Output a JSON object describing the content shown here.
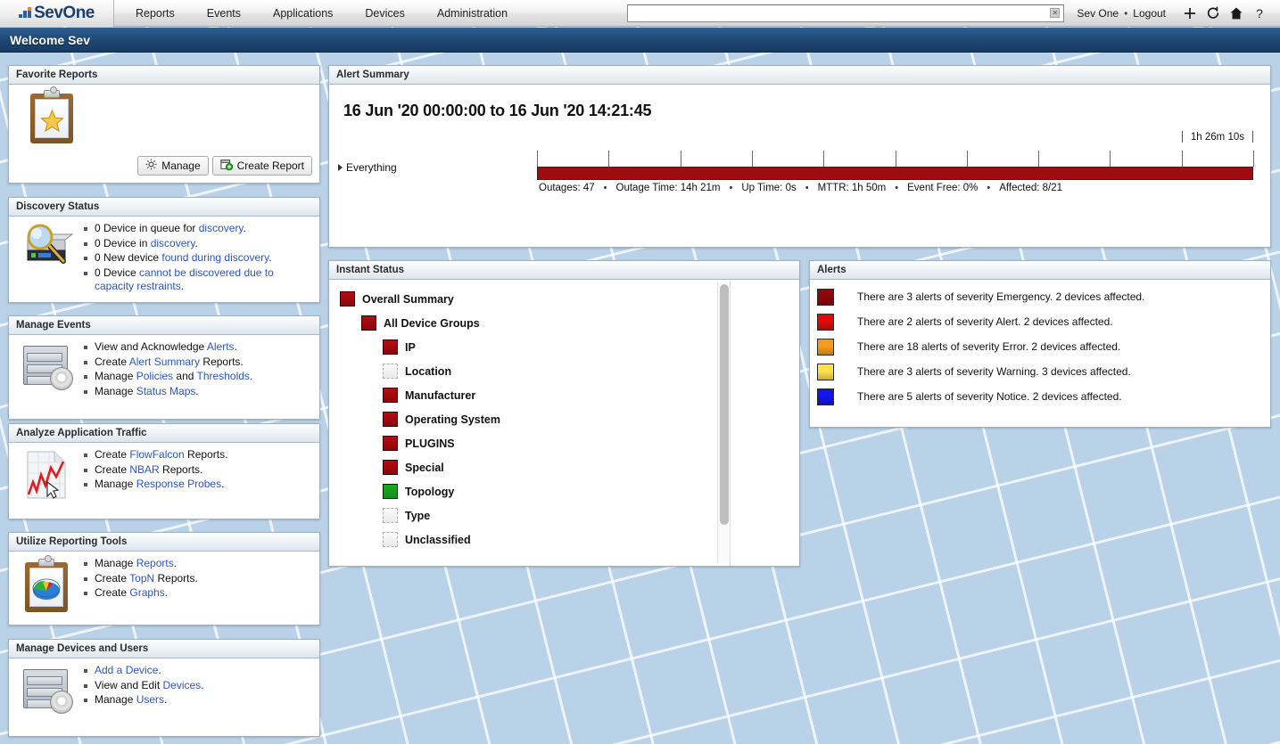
{
  "topbar": {
    "logo": "SevOne",
    "menu": [
      {
        "label": "Reports"
      },
      {
        "label": "Events"
      },
      {
        "label": "Applications"
      },
      {
        "label": "Devices"
      },
      {
        "label": "Administration"
      }
    ],
    "search": {
      "value": "",
      "placeholder": ""
    },
    "user": "Sev One",
    "separator": "•",
    "logout": "Logout",
    "icons": [
      "plus-icon",
      "refresh-icon",
      "home-icon",
      "help-icon"
    ]
  },
  "welcome": {
    "title": "Welcome Sev"
  },
  "favorite_reports": {
    "header": "Favorite Reports",
    "manage_label": "Manage",
    "create_label": "Create Report"
  },
  "discovery_status": {
    "header": "Discovery Status",
    "items": [
      {
        "pre": "0 Device in queue for ",
        "link": "discovery",
        "post": "."
      },
      {
        "pre": "0 Device in ",
        "link": "discovery",
        "post": "."
      },
      {
        "pre": "0 New device ",
        "link": "found during discovery",
        "post": "."
      },
      {
        "pre": "0 Device ",
        "link": "cannot be discovered due to capacity restraints",
        "post": "."
      }
    ]
  },
  "manage_events": {
    "header": "Manage Events",
    "items": [
      {
        "pre": "View and Acknowledge ",
        "link": "Alerts",
        "post": "."
      },
      {
        "pre": "Create ",
        "link": "Alert Summary",
        "post": " Reports."
      },
      {
        "pre": "Manage ",
        "link": "Policies",
        "mid": " and ",
        "link2": "Thresholds",
        "post": "."
      },
      {
        "pre": "Manage ",
        "link": "Status Maps",
        "post": "."
      }
    ]
  },
  "analyze_traffic": {
    "header": "Analyze Application Traffic",
    "items": [
      {
        "pre": "Create ",
        "link": "FlowFalcon",
        "post": " Reports."
      },
      {
        "pre": "Create ",
        "link": "NBAR",
        "post": " Reports."
      },
      {
        "pre": "Manage ",
        "link": "Response Probes",
        "post": "."
      }
    ]
  },
  "reporting_tools": {
    "header": "Utilize Reporting Tools",
    "items": [
      {
        "pre": "Manage ",
        "link": "Reports",
        "post": "."
      },
      {
        "pre": "Create ",
        "link": "TopN",
        "post": " Reports."
      },
      {
        "pre": "Create ",
        "link": "Graphs",
        "post": "."
      }
    ]
  },
  "devices_users": {
    "header": "Manage Devices and Users",
    "items": [
      {
        "pre": "",
        "link": "Add a Device",
        "post": "."
      },
      {
        "pre": "View and Edit ",
        "link": "Devices",
        "post": "."
      },
      {
        "pre": "Manage ",
        "link": "Users",
        "post": "."
      }
    ]
  },
  "alert_summary": {
    "header": "Alert Summary",
    "range_title": "16 Jun '20 00:00:00 to 16 Jun '20 14:21:45",
    "row_label": "Everything",
    "scale_label": "1h 26m 10s",
    "bar_color": "#9e0b10",
    "stats": [
      "Outages: 47",
      "Outage Time: 14h 21m",
      "Up Time: 0s",
      "MTTR: 1h 50m",
      "Event Free: 0%",
      "Affected: 8/21"
    ],
    "tick_count": 10
  },
  "instant_status": {
    "header": "Instant Status",
    "tree": [
      {
        "label": "Overall Summary",
        "state": "red",
        "indent": 0
      },
      {
        "label": "All Device Groups",
        "state": "red",
        "indent": 1
      },
      {
        "label": "IP",
        "state": "red",
        "indent": 2
      },
      {
        "label": "Location",
        "state": "empty",
        "indent": 2
      },
      {
        "label": "Manufacturer",
        "state": "red",
        "indent": 2
      },
      {
        "label": "Operating System",
        "state": "red",
        "indent": 2
      },
      {
        "label": "PLUGINS",
        "state": "red",
        "indent": 2
      },
      {
        "label": "Special",
        "state": "red",
        "indent": 2
      },
      {
        "label": "Topology",
        "state": "green",
        "indent": 2
      },
      {
        "label": "Type",
        "state": "empty",
        "indent": 2
      },
      {
        "label": "Unclassified",
        "state": "empty",
        "indent": 2
      }
    ]
  },
  "alerts": {
    "header": "Alerts",
    "items": [
      {
        "text": "There are 3 alerts of severity Emergency. 2 devices affected.",
        "color": "#8e0609",
        "severity": "Emergency",
        "count": 3,
        "devices": 2
      },
      {
        "text": "There are 2 alerts of severity Alert. 2 devices affected.",
        "color": "#e00c0c",
        "severity": "Alert",
        "count": 2,
        "devices": 2
      },
      {
        "text": "There are 18 alerts of severity Error. 2 devices affected.",
        "color": "#f79b1e",
        "severity": "Error",
        "count": 18,
        "devices": 2
      },
      {
        "text": "There are 3 alerts of severity Warning. 3 devices affected.",
        "color": "#ffe24a",
        "severity": "Warning",
        "count": 3,
        "devices": 3
      },
      {
        "text": "There are 5 alerts of severity Notice. 2 devices affected.",
        "color": "#1414ef",
        "severity": "Notice",
        "count": 5,
        "devices": 2
      }
    ]
  }
}
